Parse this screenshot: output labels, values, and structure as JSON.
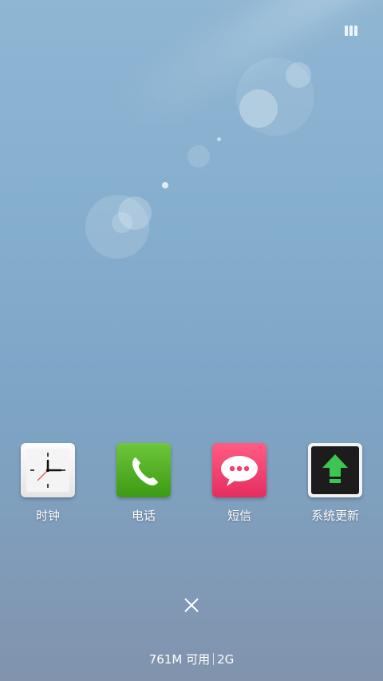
{
  "header": {
    "menu_icon": "recent-apps-icon"
  },
  "apps": [
    {
      "label": "时钟",
      "icon": "clock-icon"
    },
    {
      "label": "电话",
      "icon": "phone-icon"
    },
    {
      "label": "短信",
      "icon": "sms-icon"
    },
    {
      "label": "系统更新",
      "icon": "system-update-icon"
    }
  ],
  "clear_button": {
    "icon": "close-icon"
  },
  "memory": {
    "available": "761M 可用",
    "ram": "2G"
  },
  "colors": {
    "phone_green": "#4fae23",
    "sms_pink": "#f23f6f",
    "update_green": "#3cc651"
  }
}
